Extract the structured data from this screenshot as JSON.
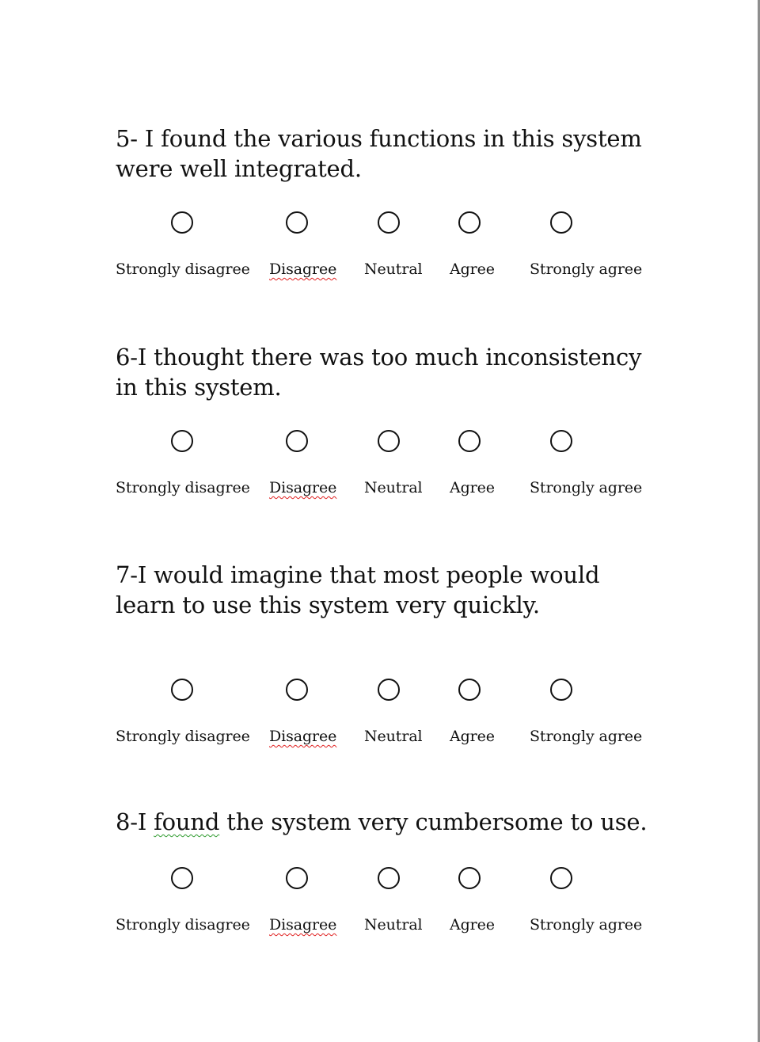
{
  "scale_options": [
    "Strongly disagree",
    "Disagree",
    "Neutral",
    "Agree",
    "Strongly agree"
  ],
  "questions": [
    {
      "number": "5-",
      "text": "I found the various functions in this system were well integrated."
    },
    {
      "number": "6-",
      "text": "I thought there was too much inconsistency in this system."
    },
    {
      "number": "7-",
      "text": "I would imagine that most people would learn to use this system very quickly."
    },
    {
      "number": "8-",
      "text_before": "I ",
      "text_marked": "found",
      "text_after": " the system very cumbersome to use."
    }
  ],
  "colors": {
    "text": "#111111",
    "spellcheck_red": "#e02020",
    "grammar_green": "#2e9a2e",
    "page_edge": "#8e8e8e"
  }
}
